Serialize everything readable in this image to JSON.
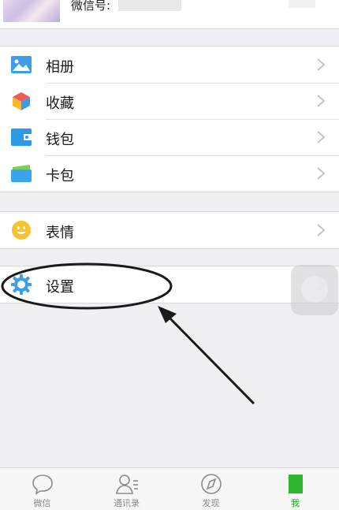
{
  "profile": {
    "wechat_id_label": "微信号:"
  },
  "menu": {
    "group1": [
      {
        "label": "相册",
        "icon": "photo-album-icon"
      },
      {
        "label": "收藏",
        "icon": "favorites-cube-icon"
      },
      {
        "label": "钱包",
        "icon": "wallet-icon"
      },
      {
        "label": "卡包",
        "icon": "card-wallet-icon"
      }
    ],
    "group2": [
      {
        "label": "表情",
        "icon": "smiley-icon"
      }
    ],
    "group3": [
      {
        "label": "设置",
        "icon": "gear-icon"
      }
    ]
  },
  "tabbar": [
    {
      "label": "微信",
      "icon": "chat-bubble-icon",
      "active": false
    },
    {
      "label": "通讯录",
      "icon": "contacts-icon",
      "active": false
    },
    {
      "label": "发现",
      "icon": "compass-icon",
      "active": false
    },
    {
      "label": "我",
      "icon": "me-icon",
      "active": true
    }
  ],
  "colors": {
    "accent_green": "#1aad19",
    "background": "#efeff4",
    "annotation": "#1a1a1a"
  }
}
